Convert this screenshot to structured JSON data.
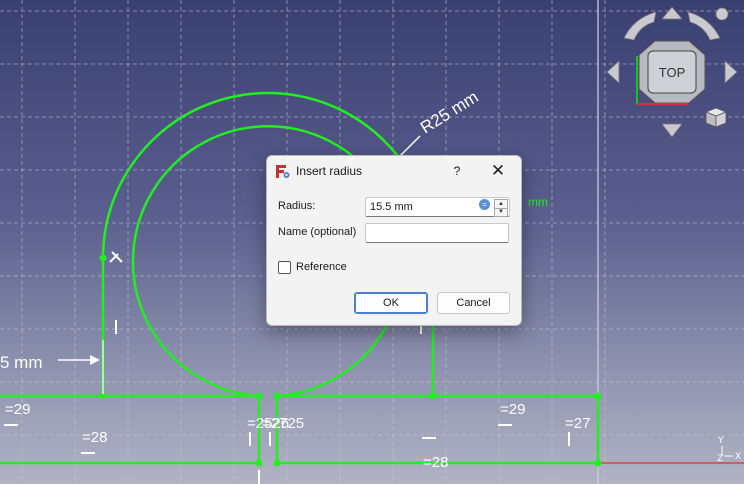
{
  "viewport": {
    "labels": {
      "r25": "R25 mm",
      "mm_left": "5 mm",
      "c29a": "=29",
      "c28a": "=28",
      "c2526": "=2526",
      "c2725": "=2725",
      "c29b": "=29",
      "c27": "=27",
      "c28b": "=28",
      "c28c": "mm"
    },
    "navcube": {
      "face": "TOP",
      "icons": [
        "rotate-left-icon",
        "rotate-right-icon",
        "arrow-up-icon",
        "arrow-down-icon",
        "arrow-left-icon",
        "arrow-right-icon",
        "view-menu-cube-icon"
      ]
    },
    "axis": {
      "x": "X",
      "y": "Y",
      "z": "Z"
    },
    "colors": {
      "geometry": "#22ee22",
      "background_top": "#3a3f72",
      "background_bottom": "#b1b3c3",
      "grid": "#c8c8d8",
      "x_axis": "#e03030",
      "y_axis": "#20c020"
    }
  },
  "dialog": {
    "title": "Insert radius",
    "help": "?",
    "close": "✕",
    "radius_label": "Radius:",
    "radius_value": "15.5 mm",
    "name_label": "Name (optional)",
    "name_value": "",
    "reference_label": "Reference",
    "reference_checked": false,
    "ok_label": "OK",
    "cancel_label": "Cancel"
  }
}
